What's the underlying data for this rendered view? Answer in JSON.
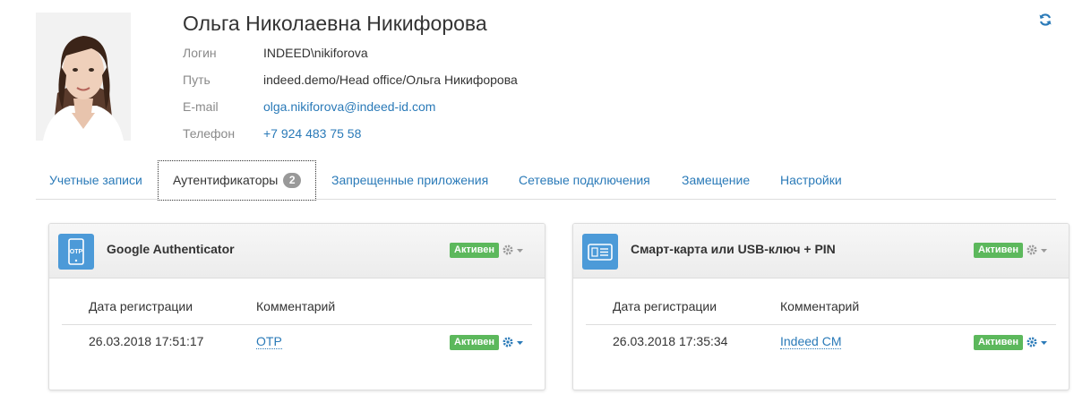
{
  "user": {
    "full_name": "Ольга Николаевна Никифорова",
    "fields": [
      {
        "label": "Логин",
        "value": "INDEED\\nikiforova"
      },
      {
        "label": "Путь",
        "value": "indeed.demo/Head office/Ольга Никифорова"
      },
      {
        "label": "E-mail",
        "value": "olga.nikiforova@indeed-id.com"
      },
      {
        "label": "Телефон",
        "value": "+7 924 483 75 58"
      }
    ]
  },
  "tabs": [
    {
      "label": "Учетные записи"
    },
    {
      "label": "Аутентификаторы",
      "badge": "2",
      "active": true
    },
    {
      "label": "Запрещенные приложения"
    },
    {
      "label": "Сетевые подключения"
    },
    {
      "label": "Замещение"
    },
    {
      "label": "Настройки"
    }
  ],
  "authenticators": [
    {
      "title": "Google Authenticator",
      "icon": "otp-phone-icon",
      "icon_label": "OTP",
      "status": "Активен",
      "columns": [
        "Дата регистрации",
        "Комментарий"
      ],
      "row": {
        "date": "26.03.2018 17:51:17",
        "comment": "OTP",
        "status": "Активен"
      }
    },
    {
      "title": "Смарт-карта или USB-ключ + PIN",
      "icon": "smart-card-icon",
      "status": "Активен",
      "columns": [
        "Дата регистрации",
        "Комментарий"
      ],
      "row": {
        "date": "26.03.2018 17:35:34",
        "comment": "Indeed CM",
        "status": "Активен"
      }
    }
  ],
  "colors": {
    "link": "#2a7ab8",
    "status_green": "#5cb85c",
    "icon_blue": "#4c9ad8",
    "badge_gray": "#999999"
  }
}
